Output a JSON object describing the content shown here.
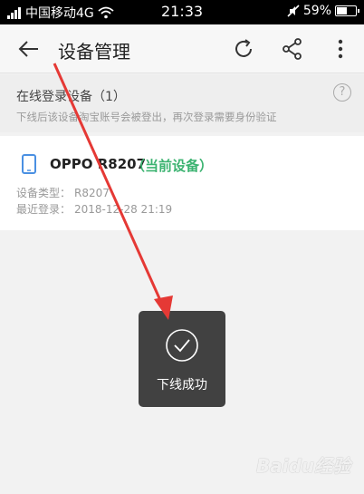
{
  "status_bar": {
    "carrier": "中国移动4G",
    "time": "21:33",
    "battery": "59%",
    "battery_level": 0.59
  },
  "app_bar": {
    "title": "设备管理",
    "icons": [
      "back-arrow-icon",
      "refresh-icon",
      "share-icon",
      "more-vertical-icon"
    ]
  },
  "section": {
    "title": "在线登录设备（1）",
    "desc": "下线后该设备淘宝账号会被登出，再次登录需要身份验证",
    "help": "?"
  },
  "device": {
    "name": "OPPO R8207",
    "current_tag": "（当前设备）",
    "type_label": "设备类型：",
    "type_value": "R8207",
    "last_login_label": "最近登录：",
    "last_login_value": "2018-12-28 21:19"
  },
  "toast": {
    "message": "下线成功"
  },
  "watermark": "Baidu经验",
  "colors": {
    "accent_green": "#3cb371",
    "annotation_red": "#e53935",
    "phone_icon_blue": "#4a90e2"
  }
}
